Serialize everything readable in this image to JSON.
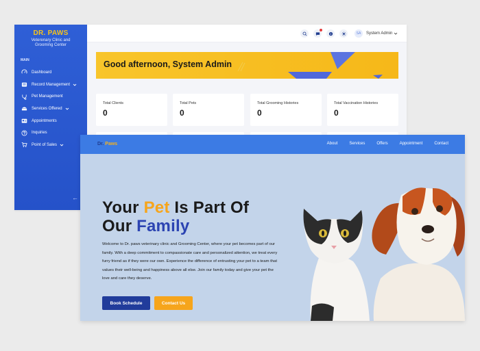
{
  "admin": {
    "brand": {
      "title": "DR. PAWS",
      "subtitle_line1": "Veterenary Clinic and",
      "subtitle_line2": "Grooming Center"
    },
    "section_label": "MAIN",
    "nav": [
      {
        "label": "Dashboard",
        "icon": "dashboard-icon",
        "has_submenu": false
      },
      {
        "label": "Record Management",
        "icon": "folder-icon",
        "has_submenu": true
      },
      {
        "label": "Pet Management",
        "icon": "paw-icon",
        "has_submenu": false
      },
      {
        "label": "Services Offered",
        "icon": "services-icon",
        "has_submenu": true
      },
      {
        "label": "Appointments",
        "icon": "calendar-icon",
        "has_submenu": false
      },
      {
        "label": "Inquiries",
        "icon": "question-icon",
        "has_submenu": false
      },
      {
        "label": "Point of Sales",
        "icon": "cart-icon",
        "has_submenu": true
      }
    ],
    "collapse_glyph": "←",
    "topbar": {
      "avatar_initials": "SA",
      "user_name": "System Admin"
    },
    "greeting": "Good afternoon, System Admin",
    "stats": [
      {
        "label": "Total Clients",
        "value": "0"
      },
      {
        "label": "Total Pets",
        "value": "0"
      },
      {
        "label": "Total Grooming Histories",
        "value": "0"
      },
      {
        "label": "Total Vaccination Histories",
        "value": "0"
      }
    ]
  },
  "site": {
    "logo_dr": "Dr.",
    "logo_paws": "Paws",
    "links": [
      "About",
      "Services",
      "Offers",
      "Appointment",
      "Contact"
    ],
    "hero": {
      "title_part1": "Your ",
      "title_highlight1": "Pet",
      "title_part2": " Is Part Of",
      "title_part3": "Our ",
      "title_highlight2": "Family",
      "body": "Welcome to Dr. paws veterinary clinic and Grooming Center, where your pet becomes part of our family. With a deep commitment to compassionate care and personalized attention, we treat every furry friend as if they were our own. Experience the difference of entrusting your pet to a team that values their well-being and happiness above all else. Join our family today and give your pet the love and care they deserve.",
      "primary_button": "Book Schedule",
      "secondary_button": "Contact Us"
    }
  },
  "colors": {
    "sidebar_blue": "#2f5fd6",
    "brand_yellow": "#f7c31b",
    "banner_yellow": "#f8c52b",
    "site_nav_blue": "#3c7be4",
    "hero_bg": "#c3d4ea",
    "accent_orange": "#f6a51c",
    "accent_navy": "#2c44b2"
  }
}
